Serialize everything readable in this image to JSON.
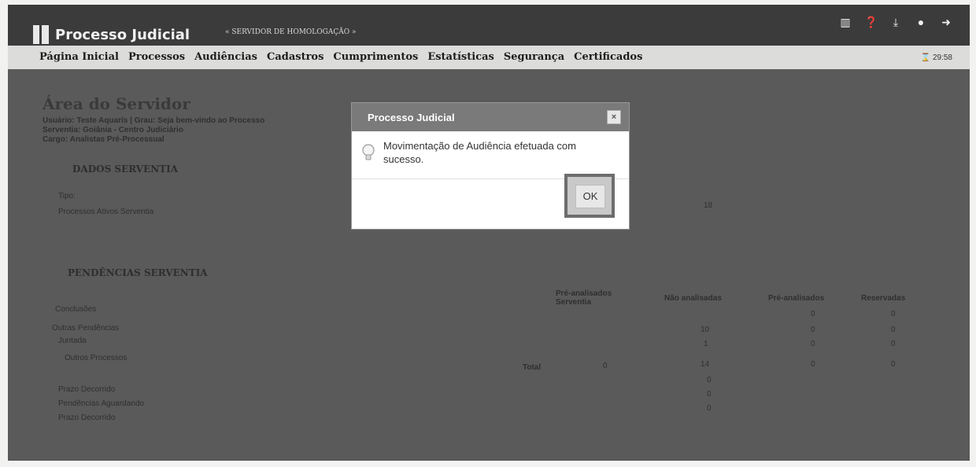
{
  "header": {
    "app_title": "Processo Judicial",
    "server_tag": "« SERVIDOR DE HOMOLOGAÇÃO »",
    "clock": "⌛ 29:58",
    "icons": [
      "chart-icon",
      "help-icon",
      "download-icon",
      "chat-icon",
      "logout-icon"
    ]
  },
  "nav": {
    "items": [
      "Página Inicial",
      "Processos",
      "Audiências",
      "Cadastros",
      "Cumprimentos",
      "Estatísticas",
      "Segurança",
      "Certificados"
    ]
  },
  "background": {
    "area_title": "Área do Servidor",
    "user_line1": "Usuário: Teste Aquarís | Grau: Seja bem-vindo ao Processo",
    "user_line2": "Serventia: Goiânia - Centro Judiciário",
    "user_line3": "Cargo: Analistas Pré-Processual",
    "section1": "DADOS SERVENTIA",
    "tipo": "Tipo:",
    "processos_ativos": "Processos Ativos Serventia",
    "processos_ativos_value": "18",
    "section2": "PENDÊNCIAS SERVENTIA",
    "col1": "Pré-analisados Serventia",
    "col2": "Não analisadas",
    "col3": "Pré-analisados",
    "col4": "Reservadas",
    "row1": "Conclusões",
    "row2": "Outras Pendências",
    "row3": "Juntada",
    "row4": "Outros Processos",
    "total_label": "Total",
    "row1_vals": [
      "0",
      "0"
    ],
    "row2_vals": [
      "10",
      "0",
      "0"
    ],
    "row3_vals": [
      "1",
      "0",
      "0"
    ],
    "total_vals": [
      "0",
      "14",
      "0",
      "0"
    ],
    "row5": "Prazo Decorrido",
    "row6": "Pendências Aguardando",
    "row7": "Prazo Decorrido",
    "row5_val": "0",
    "row6_val": "0",
    "row7_val": "0"
  },
  "modal": {
    "title": "Processo Judicial",
    "close": "×",
    "message": "Movimentação de Audiência efetuada com sucesso.",
    "ok_label": "OK"
  }
}
